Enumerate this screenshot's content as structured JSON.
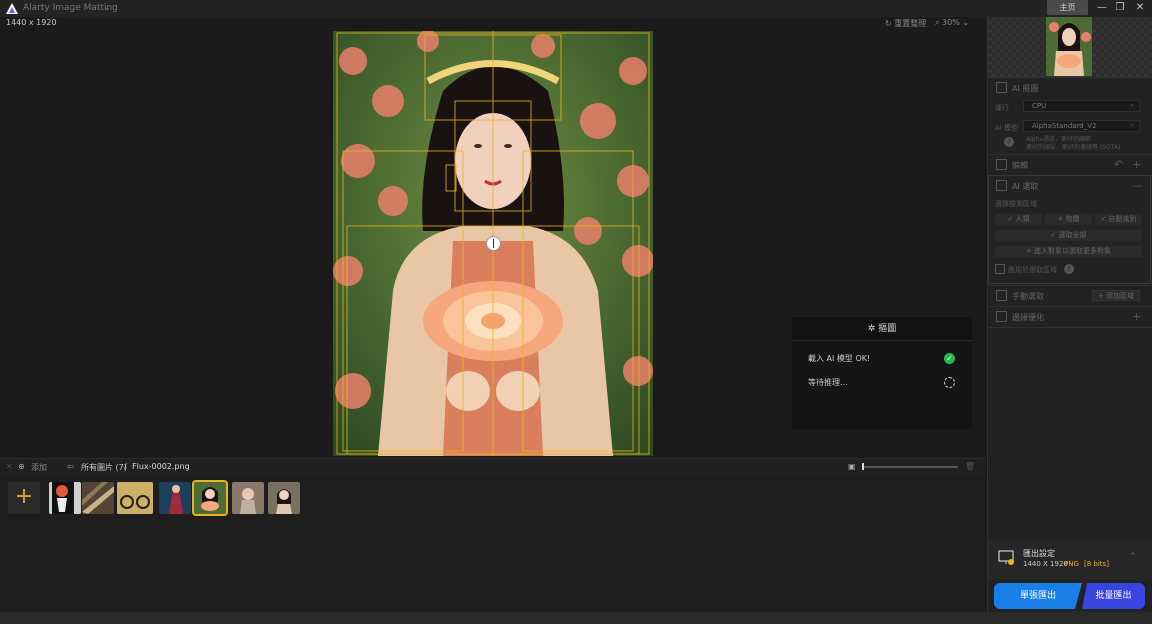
{
  "app": {
    "title": "Alarty Image Matting",
    "main_tab": "主页"
  },
  "window_controls": {
    "minimize": "—",
    "maximize": "❐",
    "close": "✕"
  },
  "canvas": {
    "dimensions": "1440 x 1920",
    "reset_label": "重置整理",
    "zoom": "30%"
  },
  "process_panel": {
    "title": "摳圖",
    "rows": [
      {
        "text": "載入 AI 模型 OK!",
        "status": "done"
      },
      {
        "text": "等待推理...",
        "status": "pending"
      }
    ]
  },
  "breadcrumb": {
    "add_label": "添加",
    "all_images": "所有圖片 (7)",
    "separator": "/",
    "current_file": "Flux-0002.png"
  },
  "thumbnails": {
    "count": 7,
    "selected_index": 4
  },
  "sidebar": {
    "ai_infer": {
      "title": "AI 摳圖",
      "device_label": "運行",
      "device_value": "CPU",
      "model_label": "AI 模型",
      "model_value": "AlphaStandard_V2",
      "model_note_1": "Alpha通道，更好的細節",
      "model_note_2": "更好的頭髮，更好的邊緣等 (SOTA)"
    },
    "edit": {
      "title": "編輯"
    },
    "ai_select": {
      "title": "AI 選取",
      "hint": "選擇檢測區域",
      "opt_person": "人類",
      "opt_object": "物體",
      "opt_auto": "自動識別",
      "btn_all": "選取全部",
      "btn_refine": "進入對象以選取更多對象",
      "checkbox": "應用於選取區域"
    },
    "manual": {
      "title": "手動選取",
      "add_btn": "+ 添加區域"
    },
    "refine": {
      "title": "邊緣優化"
    }
  },
  "export": {
    "label": "匯出設定",
    "size": "1440 X 1920",
    "format": "PNG",
    "bits": "[8 bits]",
    "single_button": "單張匯出",
    "batch_button": "批量匯出"
  },
  "colors": {
    "accent_yellow": "#e8b520",
    "export_blue": "#1a7ee8",
    "batch_indigo": "#3845e0",
    "ok_green": "#27b84a"
  }
}
